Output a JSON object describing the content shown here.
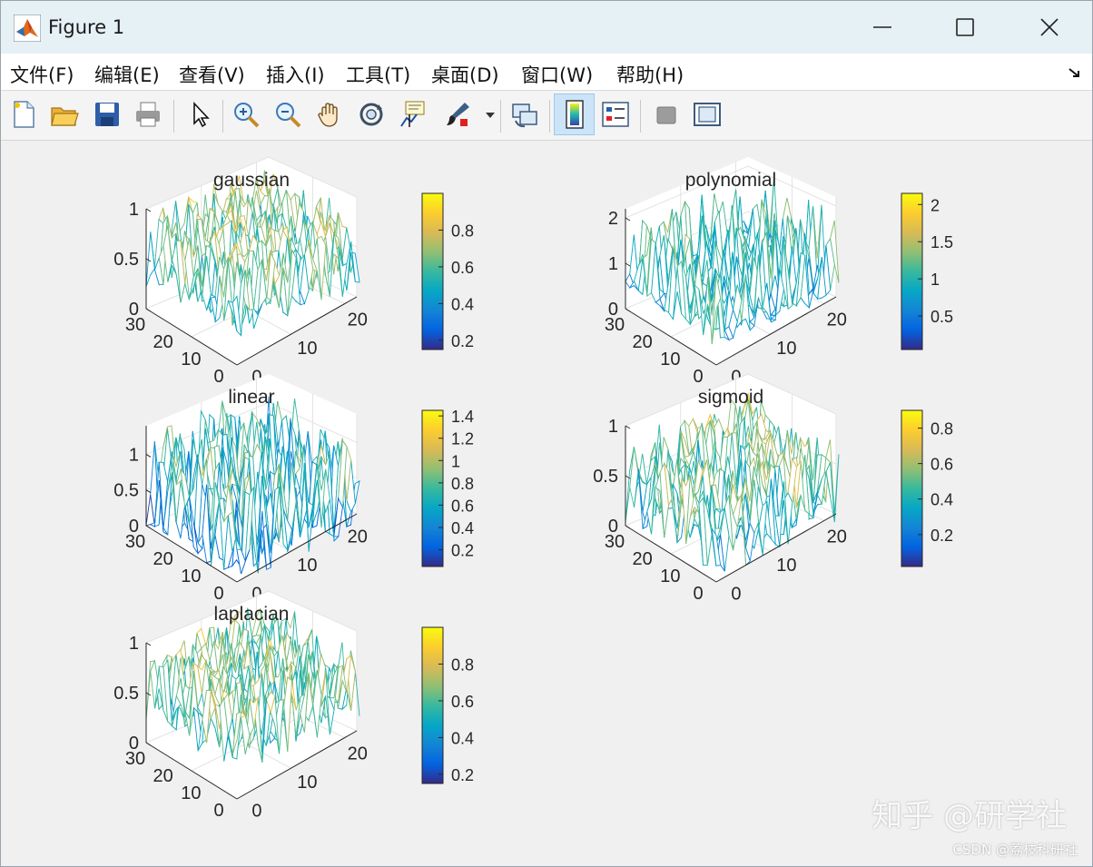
{
  "window": {
    "title": "Figure 1"
  },
  "menu": {
    "items": [
      "文件(F)",
      "编辑(E)",
      "查看(V)",
      "插入(I)",
      "工具(T)",
      "桌面(D)",
      "窗口(W)",
      "帮助(H)"
    ]
  },
  "toolbar": {
    "buttons": [
      "new-figure-icon",
      "open-file-icon",
      "save-icon",
      "print-icon",
      "pointer-icon",
      "zoom-in-icon",
      "zoom-out-icon",
      "pan-hand-icon",
      "rotate-3d-icon",
      "data-cursor-icon",
      "brush-icon",
      "link-plot-icon",
      "colorbar-icon",
      "legend-icon",
      "hide-plot-tools-icon",
      "show-plot-tools-icon"
    ],
    "active": "colorbar-icon"
  },
  "colors": {
    "titlebar": "#e6f1f5",
    "canvas": "#f0f0f0",
    "parula": [
      "#352a87",
      "#0363e1",
      "#1485d4",
      "#06a7c6",
      "#38b99e",
      "#92bf73",
      "#d9ba56",
      "#fcce2e",
      "#f9fb0e"
    ]
  },
  "chart_data": [
    {
      "type": "surface",
      "title": "gaussian",
      "zticks": [
        "0",
        "0.5",
        "1"
      ],
      "xticks": [
        "0",
        "10",
        "20"
      ],
      "yticks": [
        "0",
        "10",
        "20",
        "30"
      ],
      "zlim": [
        0,
        1
      ],
      "colorbar_ticks": [
        {
          "value": 0.2,
          "label": "0.2"
        },
        {
          "value": 0.4,
          "label": "0.4"
        },
        {
          "value": 0.6,
          "label": "0.6"
        },
        {
          "value": 0.8,
          "label": "0.8"
        }
      ],
      "color_range": [
        0.15,
        1.0
      ],
      "z_mean": 0.6,
      "z_amp": 0.38
    },
    {
      "type": "surface",
      "title": "polynomial",
      "zticks": [
        "0",
        "1",
        "2"
      ],
      "xticks": [
        "0",
        "10",
        "20"
      ],
      "yticks": [
        "0",
        "10",
        "20",
        "30"
      ],
      "zlim": [
        0,
        2.2
      ],
      "colorbar_ticks": [
        {
          "value": 0.5,
          "label": "0.5"
        },
        {
          "value": 1.0,
          "label": "1"
        },
        {
          "value": 1.5,
          "label": "1.5"
        },
        {
          "value": 2.0,
          "label": "2"
        }
      ],
      "color_range": [
        0.05,
        2.15
      ],
      "z_mean": 0.35,
      "z_amp": 1.6
    },
    {
      "type": "surface",
      "title": "linear",
      "zticks": [
        "0",
        "0.5",
        "1"
      ],
      "xticks": [
        "0",
        "10",
        "20"
      ],
      "yticks": [
        "0",
        "10",
        "20",
        "30"
      ],
      "zlim": [
        0,
        1.4
      ],
      "colorbar_ticks": [
        {
          "value": 0.2,
          "label": "0.2"
        },
        {
          "value": 0.4,
          "label": "0.4"
        },
        {
          "value": 0.6,
          "label": "0.6"
        },
        {
          "value": 0.8,
          "label": "0.8"
        },
        {
          "value": 1.0,
          "label": "1"
        },
        {
          "value": 1.2,
          "label": "1.2"
        },
        {
          "value": 1.4,
          "label": "1.4"
        }
      ],
      "color_range": [
        0.05,
        1.45
      ],
      "z_mean": 0.5,
      "z_amp": 0.8
    },
    {
      "type": "surface",
      "title": "sigmoid",
      "zticks": [
        "0",
        "0.5",
        "1"
      ],
      "xticks": [
        "0",
        "10",
        "20"
      ],
      "yticks": [
        "0",
        "10",
        "20",
        "30"
      ],
      "zlim": [
        0,
        1
      ],
      "colorbar_ticks": [
        {
          "value": 0.2,
          "label": "0.2"
        },
        {
          "value": 0.4,
          "label": "0.4"
        },
        {
          "value": 0.6,
          "label": "0.6"
        },
        {
          "value": 0.8,
          "label": "0.8"
        }
      ],
      "color_range": [
        0.02,
        0.9
      ],
      "z_mean": 0.45,
      "z_amp": 0.42
    },
    {
      "type": "surface",
      "title": "laplacian",
      "zticks": [
        "0",
        "0.5",
        "1"
      ],
      "xticks": [
        "0",
        "10",
        "20"
      ],
      "yticks": [
        "0",
        "10",
        "20",
        "30"
      ],
      "zlim": [
        0,
        1
      ],
      "colorbar_ticks": [
        {
          "value": 0.2,
          "label": "0.2"
        },
        {
          "value": 0.4,
          "label": "0.4"
        },
        {
          "value": 0.6,
          "label": "0.6"
        },
        {
          "value": 0.8,
          "label": "0.8"
        }
      ],
      "color_range": [
        0.15,
        1.0
      ],
      "z_mean": 0.6,
      "z_amp": 0.38
    }
  ],
  "watermark": {
    "main": "知乎 @研学社",
    "sub": "CSDN @荔枝科研社"
  }
}
